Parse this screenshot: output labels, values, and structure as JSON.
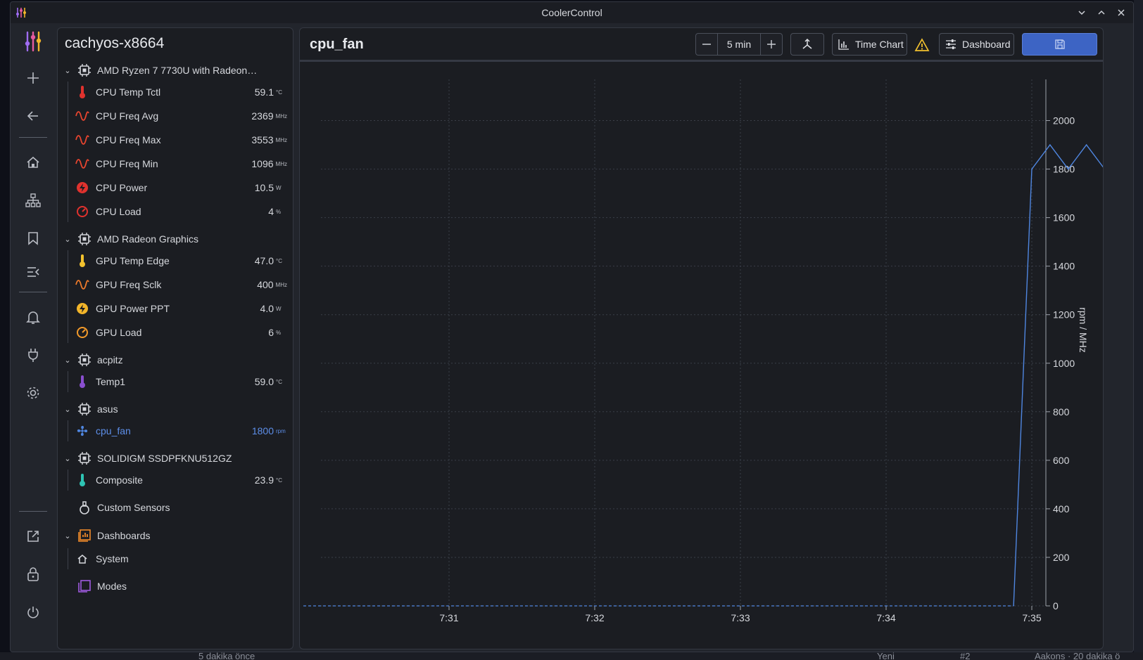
{
  "window": {
    "title": "CoolerControl"
  },
  "host": {
    "name": "cachyos-x8664"
  },
  "groups": [
    {
      "name": "AMD Ryzen 7 7730U with Radeon…",
      "items": [
        {
          "label": "CPU Temp Tctl",
          "value": "59.1",
          "unit": "°C",
          "icon": "thermometer-icon",
          "color": "#e0322e"
        },
        {
          "label": "CPU Freq Avg",
          "value": "2369",
          "unit": "MHz",
          "icon": "wave-icon",
          "color": "#e8452f"
        },
        {
          "label": "CPU Freq Max",
          "value": "3553",
          "unit": "MHz",
          "icon": "wave-icon",
          "color": "#e8452f"
        },
        {
          "label": "CPU Freq Min",
          "value": "1096",
          "unit": "MHz",
          "icon": "wave-icon",
          "color": "#e8452f"
        },
        {
          "label": "CPU Power",
          "value": "10.5",
          "unit": "W",
          "icon": "power-icon",
          "color": "#e0322e"
        },
        {
          "label": "CPU Load",
          "value": "4",
          "unit": "%",
          "icon": "gauge-icon",
          "color": "#e0322e"
        }
      ]
    },
    {
      "name": "AMD Radeon Graphics",
      "items": [
        {
          "label": "GPU Temp Edge",
          "value": "47.0",
          "unit": "°C",
          "icon": "thermometer-icon",
          "color": "#f2c12e"
        },
        {
          "label": "GPU Freq Sclk",
          "value": "400",
          "unit": "MHz",
          "icon": "wave-icon",
          "color": "#ef7a2a"
        },
        {
          "label": "GPU Power PPT",
          "value": "4.0",
          "unit": "W",
          "icon": "power-icon",
          "color": "#f2b52a"
        },
        {
          "label": "GPU Load",
          "value": "6",
          "unit": "%",
          "icon": "gauge-icon",
          "color": "#f29a2a"
        }
      ]
    },
    {
      "name": "acpitz",
      "items": [
        {
          "label": "Temp1",
          "value": "59.0",
          "unit": "°C",
          "icon": "thermometer-icon",
          "color": "#8a4fcf"
        }
      ]
    },
    {
      "name": "asus",
      "items": [
        {
          "label": "cpu_fan",
          "value": "1800",
          "unit": "rpm",
          "icon": "fan-icon",
          "color": "#4f86e0",
          "active": true
        }
      ]
    },
    {
      "name": "SOLIDIGM SSDPFKNU512GZ",
      "items": [
        {
          "label": "Composite",
          "value": "23.9",
          "unit": "°C",
          "icon": "thermometer-icon",
          "color": "#2ec4b4"
        }
      ]
    }
  ],
  "custom_sensors": {
    "label": "Custom Sensors"
  },
  "dashboards": {
    "label": "Dashboards",
    "items": [
      {
        "label": "System"
      }
    ]
  },
  "modes": {
    "label": "Modes"
  },
  "toolbar": {
    "title": "cpu_fan",
    "range_value": "5 min",
    "time_chart_label": "Time Chart",
    "dashboard_label": "Dashboard"
  },
  "colors": {
    "accent": "#3d64c4",
    "series": "#4f86e0"
  },
  "chart_data": {
    "type": "line",
    "ylabel": "rpm / MHz",
    "ylim": [
      0,
      2100
    ],
    "yticks": [
      0,
      200,
      400,
      600,
      800,
      1000,
      1200,
      1400,
      1600,
      1800,
      2000
    ],
    "xticks": [
      "7:31",
      "7:32",
      "7:33",
      "7:34",
      "7:35"
    ],
    "grid": true,
    "series": [
      {
        "x": [
          7.2,
          7.3,
          7.4,
          7.5,
          7.6,
          7.7,
          7.8,
          7.9,
          7.98,
          8.0,
          8.02,
          8.04,
          8.06,
          8.08
        ],
        "values": [
          0,
          0,
          0,
          0,
          0,
          0,
          0,
          0,
          0,
          1800,
          1900,
          1800,
          1900,
          1800
        ]
      }
    ]
  },
  "taskbar": {
    "left_text": "5 dakika önce",
    "badge": "Yeni",
    "num": "#2",
    "right_text": "Aakons · 20 dakika ö"
  }
}
